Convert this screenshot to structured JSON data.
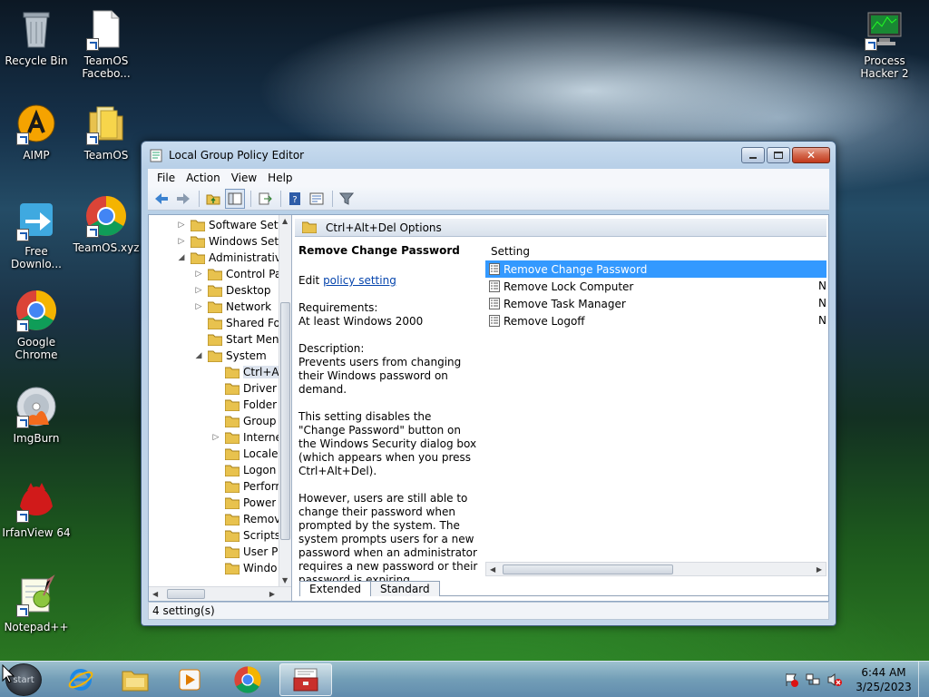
{
  "desktop": {
    "icons": [
      {
        "label": "Recycle Bin"
      },
      {
        "label": "TeamOS Facebo..."
      },
      {
        "label": "Process Hacker 2"
      },
      {
        "label": "AIMP"
      },
      {
        "label": "TeamOS"
      },
      {
        "label": "Free Downlo..."
      },
      {
        "label": "TeamOS.xyz"
      },
      {
        "label": "Google Chrome"
      },
      {
        "label": "ImgBurn"
      },
      {
        "label": "IrfanView 64"
      },
      {
        "label": "Notepad++"
      }
    ]
  },
  "window": {
    "title": "Local Group Policy Editor",
    "menu": [
      "File",
      "Action",
      "View",
      "Help"
    ],
    "tree": [
      {
        "label": "Software Setti",
        "indent": 0,
        "expander": "▷"
      },
      {
        "label": "Windows Sett",
        "indent": 0,
        "expander": "▷"
      },
      {
        "label": "Administrative",
        "indent": 0,
        "expander": "◢"
      },
      {
        "label": "Control Pa",
        "indent": 1,
        "expander": "▷"
      },
      {
        "label": "Desktop",
        "indent": 1,
        "expander": "▷"
      },
      {
        "label": "Network",
        "indent": 1,
        "expander": "▷"
      },
      {
        "label": "Shared Fol",
        "indent": 1,
        "expander": ""
      },
      {
        "label": "Start Menu",
        "indent": 1,
        "expander": ""
      },
      {
        "label": "System",
        "indent": 1,
        "expander": "◢"
      },
      {
        "label": "Ctrl+A",
        "indent": 2,
        "expander": "",
        "selected": true
      },
      {
        "label": "Driver I",
        "indent": 2,
        "expander": ""
      },
      {
        "label": "Folder I",
        "indent": 2,
        "expander": ""
      },
      {
        "label": "Group",
        "indent": 2,
        "expander": ""
      },
      {
        "label": "Interne",
        "indent": 2,
        "expander": "▷"
      },
      {
        "label": "Locale",
        "indent": 2,
        "expander": ""
      },
      {
        "label": "Logon",
        "indent": 2,
        "expander": ""
      },
      {
        "label": "Perforn",
        "indent": 2,
        "expander": ""
      },
      {
        "label": "Power",
        "indent": 2,
        "expander": ""
      },
      {
        "label": "Remov",
        "indent": 2,
        "expander": ""
      },
      {
        "label": "Scripts",
        "indent": 2,
        "expander": ""
      },
      {
        "label": "User Pr",
        "indent": 2,
        "expander": ""
      },
      {
        "label": "Windo",
        "indent": 2,
        "expander": ""
      }
    ],
    "section_title": "Ctrl+Alt+Del Options",
    "description": {
      "heading": "Remove Change Password",
      "edit_prefix": "Edit ",
      "edit_link": "policy setting",
      "requirements_label": "Requirements:",
      "requirements_value": "At least Windows 2000",
      "description_label": "Description:",
      "para1": "Prevents users from changing their Windows password on demand.",
      "para2": "This setting disables the \"Change Password\" button on the Windows Security dialog box (which appears when you press Ctrl+Alt+Del).",
      "para3": "However, users are still able to change their password when prompted by the system. The system prompts users for a new password when an administrator requires a new password or their password is expiring."
    },
    "list": {
      "column": "Setting",
      "rows": [
        {
          "name": "Remove Change Password",
          "state": "",
          "selected": true
        },
        {
          "name": "Remove Lock Computer",
          "state": "N"
        },
        {
          "name": "Remove Task Manager",
          "state": "N"
        },
        {
          "name": "Remove Logoff",
          "state": "N"
        }
      ]
    },
    "tabs": [
      "Extended",
      "Standard"
    ],
    "status": "4 setting(s)"
  },
  "taskbar": {
    "start_label": "start",
    "clock_time": "6:44 AM",
    "clock_date": "3/25/2023"
  },
  "colors": {
    "selection": "#3399ff",
    "link": "#0645ad",
    "close_button": "#c2391b"
  }
}
